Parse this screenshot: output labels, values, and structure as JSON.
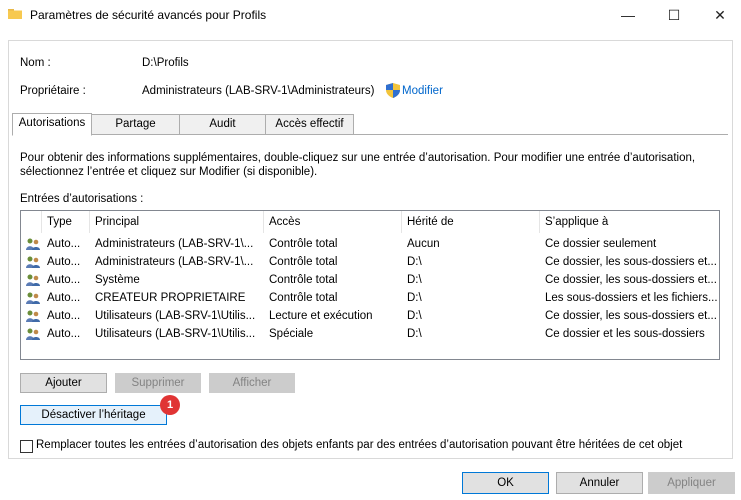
{
  "window": {
    "title": "Paramètres de sécurité avancés pour Profils",
    "minimize": "—",
    "maximize": "☐",
    "close": "✕"
  },
  "header": {
    "name_label": "Nom :",
    "name_value": "D:\\Profils",
    "owner_label": "Propriétaire :",
    "owner_value": "Administrateurs (LAB-SRV-1\\Administrateurs)",
    "change_link": "Modifier"
  },
  "tabs": [
    {
      "label": "Autorisations",
      "active": true
    },
    {
      "label": "Partage",
      "active": false
    },
    {
      "label": "Audit",
      "active": false
    },
    {
      "label": "Accès effectif",
      "active": false
    }
  ],
  "description": "Pour obtenir des informations supplémentaires, double-cliquez sur une entrée d’autorisation. Pour modifier une entrée d’autorisation, sélectionnez l’entrée et cliquez sur Modifier (si disponible).",
  "entries_label": "Entrées d’autorisations :",
  "columns": {
    "type": "Type",
    "principal": "Principal",
    "access": "Accès",
    "inherited": "Hérité de",
    "applies": "S’applique à"
  },
  "rows": [
    {
      "type": "Auto...",
      "principal": "Administrateurs (LAB-SRV-1\\...",
      "access": "Contrôle total",
      "inherited": "Aucun",
      "applies": "Ce dossier seulement"
    },
    {
      "type": "Auto...",
      "principal": "Administrateurs (LAB-SRV-1\\...",
      "access": "Contrôle total",
      "inherited": "D:\\",
      "applies": "Ce dossier, les sous-dossiers et..."
    },
    {
      "type": "Auto...",
      "principal": "Système",
      "access": "Contrôle total",
      "inherited": "D:\\",
      "applies": "Ce dossier, les sous-dossiers et..."
    },
    {
      "type": "Auto...",
      "principal": "CREATEUR PROPRIETAIRE",
      "access": "Contrôle total",
      "inherited": "D:\\",
      "applies": "Les sous-dossiers et les fichiers..."
    },
    {
      "type": "Auto...",
      "principal": "Utilisateurs (LAB-SRV-1\\Utilis...",
      "access": "Lecture et exécution",
      "inherited": "D:\\",
      "applies": "Ce dossier, les sous-dossiers et..."
    },
    {
      "type": "Auto...",
      "principal": "Utilisateurs (LAB-SRV-1\\Utilis...",
      "access": "Spéciale",
      "inherited": "D:\\",
      "applies": "Ce dossier et les sous-dossiers"
    }
  ],
  "buttons": {
    "add": "Ajouter",
    "remove": "Supprimer",
    "view": "Afficher",
    "disable_inheritance": "Désactiver l’héritage",
    "badge": "1"
  },
  "replace_checkbox": "Remplacer toutes les entrées d’autorisation des objets enfants par des entrées d’autorisation pouvant être héritées de cet objet",
  "footer": {
    "ok": "OK",
    "cancel": "Annuler",
    "apply": "Appliquer"
  }
}
